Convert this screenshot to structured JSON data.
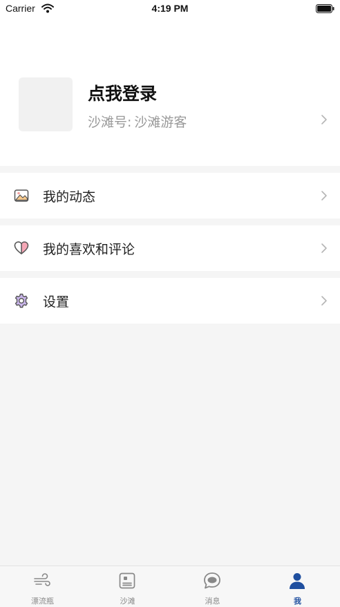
{
  "status_bar": {
    "carrier": "Carrier",
    "time": "4:19 PM"
  },
  "profile": {
    "login_prompt": "点我登录",
    "beach_id_label": "沙滩号:",
    "beach_id_value": "沙滩游客"
  },
  "menu": {
    "items": [
      {
        "label": "我的动态",
        "icon": "image-icon"
      },
      {
        "label": "我的喜欢和评论",
        "icon": "heart-icon"
      },
      {
        "label": "设置",
        "icon": "gear-icon"
      }
    ]
  },
  "tab_bar": {
    "active_color": "#1f4f9f",
    "items": [
      {
        "label": "漂流瓶",
        "icon": "wind-icon",
        "active": false
      },
      {
        "label": "沙滩",
        "icon": "card-icon",
        "active": false
      },
      {
        "label": "消息",
        "icon": "chat-bubble-icon",
        "active": false
      },
      {
        "label": "我",
        "icon": "person-icon",
        "active": true
      }
    ]
  }
}
